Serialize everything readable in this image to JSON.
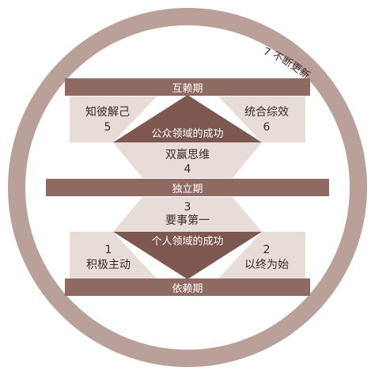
{
  "diagram": {
    "ring_label": "7 不断更新",
    "bands": {
      "top": "互赖期",
      "middle": "独立期",
      "bottom": "依赖期"
    },
    "upper_section": {
      "left_habit": {
        "name": "知彼解己",
        "number": "5"
      },
      "right_habit": {
        "name": "统合综效",
        "number": "6"
      },
      "center_victory": "公众领域的成功",
      "lower_habit": {
        "name": "双赢思维",
        "number": "4"
      }
    },
    "lower_section": {
      "upper_habit": {
        "number": "3",
        "name": "要事第一"
      },
      "center_victory": "个人领域的成功",
      "left_habit": {
        "number": "1",
        "name": "积极主动"
      },
      "right_habit": {
        "number": "2",
        "name": "以终为始"
      }
    },
    "colors": {
      "ring": "#b9a099",
      "band_dark": "#8f6a62",
      "center_dark": "#7e5850",
      "fill_light": "#e8dcd8",
      "background": "#ffffff"
    }
  }
}
